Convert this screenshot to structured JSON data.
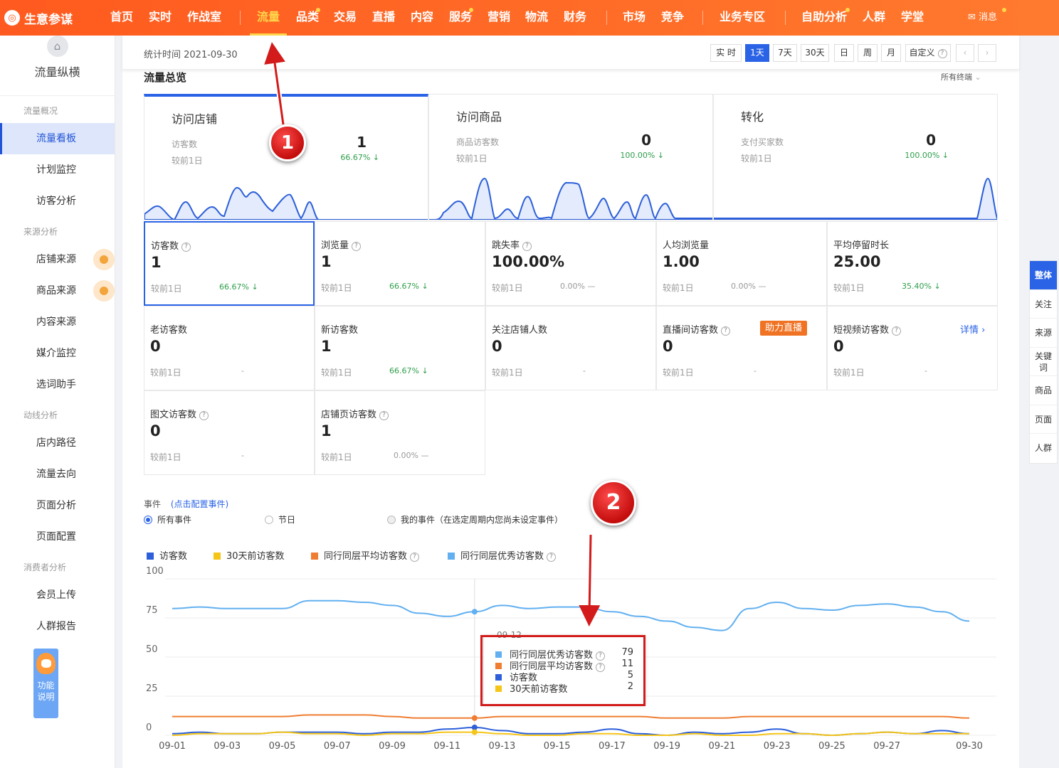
{
  "app": {
    "title": "生意参谋",
    "message": "消息"
  },
  "nav": [
    {
      "label": "首页"
    },
    {
      "label": "实时"
    },
    {
      "label": "作战室"
    },
    {
      "label": "流量"
    },
    {
      "label": "品类"
    },
    {
      "label": "交易"
    },
    {
      "label": "直播"
    },
    {
      "label": "内容"
    },
    {
      "label": "服务"
    },
    {
      "label": "营销"
    },
    {
      "label": "物流"
    },
    {
      "label": "财务"
    },
    {
      "label": "市场"
    },
    {
      "label": "竞争"
    },
    {
      "label": "业务专区"
    },
    {
      "label": "自助分析"
    },
    {
      "label": "人群"
    },
    {
      "label": "学堂"
    }
  ],
  "sidebar": {
    "title": "流量纵横",
    "groups": [
      "流量概况",
      "来源分析",
      "动线分析",
      "消费者分析"
    ],
    "items": [
      "流量看板",
      "计划监控",
      "访客分析",
      "店铺来源",
      "商品来源",
      "内容来源",
      "媒介监控",
      "选词助手",
      "店内路径",
      "流量去向",
      "页面分析",
      "页面配置",
      "会员上传",
      "人群报告"
    ],
    "help": "功能说明"
  },
  "toolbar": {
    "stat_time": "统计时间 2021-09-30",
    "periods": [
      "实 时",
      "1天",
      "7天",
      "30天",
      "日",
      "周",
      "月",
      "自定义"
    ]
  },
  "overview": {
    "title": "流量总览",
    "terminal": "所有终端",
    "cards": [
      {
        "title": "访问店铺",
        "label": "访客数",
        "compare": "较前1日",
        "value": "1",
        "change": "66.67% ↓"
      },
      {
        "title": "访问商品",
        "label": "商品访客数",
        "compare": "较前1日",
        "value": "0",
        "change": "100.00% ↓"
      },
      {
        "title": "转化",
        "label": "支付买家数",
        "compare": "较前1日",
        "value": "0",
        "change": "100.00% ↓"
      }
    ]
  },
  "metrics": [
    {
      "name": "访客数",
      "value": "1",
      "compare": "较前1日",
      "change": "66.67% ↓"
    },
    {
      "name": "浏览量",
      "value": "1",
      "compare": "较前1日",
      "change": "66.67% ↓"
    },
    {
      "name": "跳失率",
      "value": "100.00%",
      "compare": "较前1日",
      "change": "0.00% —"
    },
    {
      "name": "人均浏览量",
      "value": "1.00",
      "compare": "较前1日",
      "change": "0.00% —"
    },
    {
      "name": "平均停留时长",
      "value": "25.00",
      "compare": "较前1日",
      "change": "35.40% ↓"
    },
    {
      "name": "老访客数",
      "value": "0",
      "compare": "较前1日",
      "change": "-"
    },
    {
      "name": "新访客数",
      "value": "1",
      "compare": "较前1日",
      "change": "66.67% ↓"
    },
    {
      "name": "关注店铺人数",
      "value": "0",
      "compare": "较前1日",
      "change": "-"
    },
    {
      "name": "直播间访客数",
      "value": "0",
      "compare": "较前1日",
      "change": "-",
      "badge": "助力直播"
    },
    {
      "name": "短视频访客数",
      "value": "0",
      "compare": "较前1日",
      "change": "-",
      "detail": "详情 ›"
    },
    {
      "name": "图文访客数",
      "value": "0",
      "compare": "较前1日",
      "change": "-"
    },
    {
      "name": "店铺页访客数",
      "value": "1",
      "compare": "较前1日",
      "change": "0.00% —"
    }
  ],
  "events": {
    "label": "事件",
    "link": "(点击配置事件)",
    "options": [
      "所有事件",
      "节日",
      "我的事件（在选定周期内您尚未设定事件）"
    ]
  },
  "annotations": {
    "one": "1",
    "two": "2"
  },
  "right_panel": [
    "整体",
    "关注",
    "来源",
    "关键词",
    "商品",
    "页面",
    "人群"
  ],
  "colors": {
    "brand": "#ff5a1f",
    "accent": "#2a63e6",
    "visitors": "#2c5fd9",
    "prev30": "#f5c518",
    "avg": "#ef7d32",
    "excellent": "#62b0f0"
  },
  "chart_data": {
    "type": "line",
    "series_legend": [
      "访客数",
      "30天前访客数",
      "同行同层平均访客数",
      "同行同层优秀访客数"
    ],
    "x": [
      "09-01",
      "09-02",
      "09-03",
      "09-04",
      "09-05",
      "09-06",
      "09-07",
      "09-08",
      "09-09",
      "09-10",
      "09-11",
      "09-12",
      "09-13",
      "09-14",
      "09-15",
      "09-16",
      "09-17",
      "09-18",
      "09-19",
      "09-20",
      "09-21",
      "09-22",
      "09-23",
      "09-24",
      "09-25",
      "09-26",
      "09-27",
      "09-28",
      "09-29",
      "09-30"
    ],
    "xticks": [
      "09-01",
      "09-03",
      "09-05",
      "09-07",
      "09-09",
      "09-11",
      "09-13",
      "09-15",
      "09-17",
      "09-19",
      "09-21",
      "09-23",
      "09-25",
      "09-27",
      "09-30"
    ],
    "yticks": [
      "100",
      "75",
      "50",
      "25",
      "0"
    ],
    "ylim": [
      0,
      100
    ],
    "series": [
      {
        "name": "同行同层优秀访客数",
        "color": "#62b0f0",
        "values": [
          81,
          82,
          81,
          81,
          81,
          86,
          86,
          85,
          83,
          78,
          76,
          79,
          83,
          81,
          82,
          82,
          79,
          76,
          73,
          69,
          67,
          81,
          85,
          81,
          80,
          83,
          84,
          82,
          79,
          73
        ]
      },
      {
        "name": "同行同层平均访客数",
        "color": "#ef7d32",
        "values": [
          12,
          12,
          12,
          12,
          12,
          13,
          13,
          13,
          12,
          11,
          11,
          11,
          12,
          12,
          12,
          12,
          12,
          12,
          11,
          11,
          11,
          12,
          12,
          12,
          12,
          12,
          12,
          12,
          12,
          11
        ]
      },
      {
        "name": "访客数",
        "color": "#2c5fd9",
        "values": [
          1,
          2,
          1,
          1,
          2,
          2,
          2,
          1,
          2,
          2,
          4,
          5,
          3,
          1,
          1,
          2,
          4,
          1,
          0,
          2,
          1,
          2,
          4,
          1,
          0,
          1,
          2,
          1,
          3,
          1
        ]
      },
      {
        "name": "30天前访客数",
        "color": "#f5c518",
        "values": [
          0,
          1,
          1,
          1,
          2,
          1,
          1,
          0,
          1,
          1,
          2,
          2,
          1,
          0,
          0,
          1,
          1,
          0,
          0,
          1,
          0,
          0,
          1,
          1,
          0,
          1,
          2,
          1,
          1,
          1
        ]
      }
    ],
    "tooltip": {
      "date": "09-12",
      "rows": [
        {
          "name": "同行同层优秀访客数",
          "value": "79",
          "color": "#62b0f0"
        },
        {
          "name": "同行同层平均访客数",
          "value": "11",
          "color": "#ef7d32"
        },
        {
          "name": "访客数",
          "value": "5",
          "color": "#2c5fd9"
        },
        {
          "name": "30天前访客数",
          "value": "2",
          "color": "#f5c518"
        }
      ]
    }
  }
}
